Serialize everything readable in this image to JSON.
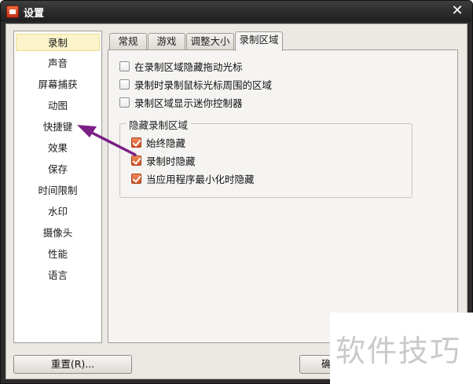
{
  "window": {
    "title": "设置",
    "close_glyph": "✕"
  },
  "sidebar": {
    "items": [
      {
        "label": "录制",
        "active": true
      },
      {
        "label": "声音"
      },
      {
        "label": "屏幕捕获"
      },
      {
        "label": "动图"
      },
      {
        "label": "快捷键"
      },
      {
        "label": "效果"
      },
      {
        "label": "保存"
      },
      {
        "label": "时间限制"
      },
      {
        "label": "水印"
      },
      {
        "label": "摄像头"
      },
      {
        "label": "性能"
      },
      {
        "label": "语言"
      }
    ]
  },
  "tabs": [
    {
      "label": "常规"
    },
    {
      "label": "游戏"
    },
    {
      "label": "调整大小"
    },
    {
      "label": "录制区域",
      "active": true
    }
  ],
  "panel": {
    "options": [
      {
        "label": "在录制区域隐藏拖动光标",
        "checked": false
      },
      {
        "label": "录制时录制鼠标光标周围的区域",
        "checked": false
      },
      {
        "label": "录制区域显示迷你控制器",
        "checked": false
      }
    ],
    "hide_group": {
      "title": "隐藏录制区域",
      "options": [
        {
          "label": "始终隐藏",
          "checked": true
        },
        {
          "label": "录制时隐藏",
          "checked": true
        },
        {
          "label": "当应用程序最小化时隐藏",
          "checked": true
        }
      ]
    }
  },
  "footer": {
    "reset_label": "重置(R)...",
    "ok_label": "确"
  },
  "colors": {
    "accent_arrow": "#7b1f86",
    "checkbox_checked": "#e06a3c"
  },
  "watermark": {
    "text": "软件技巧"
  }
}
